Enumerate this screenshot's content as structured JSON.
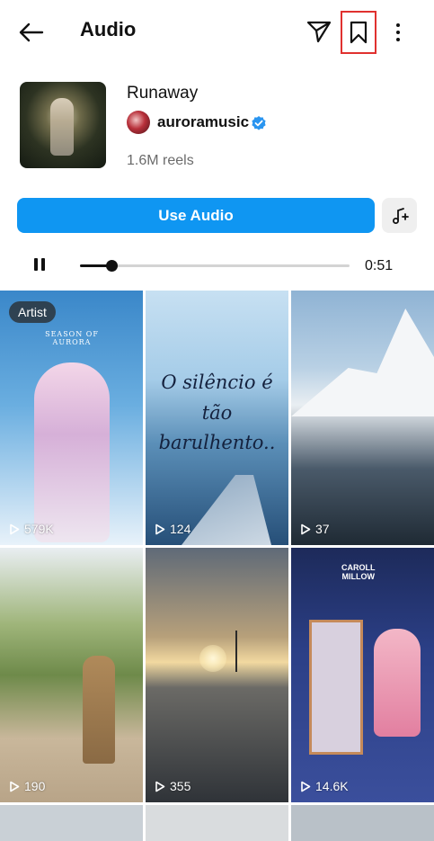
{
  "header": {
    "title": "Audio",
    "icons": [
      "back-arrow-icon",
      "send-icon",
      "bookmark-icon",
      "more-options-icon"
    ]
  },
  "track": {
    "title": "Runaway",
    "artist": "auroramusic",
    "verified": true,
    "reels_count": "1.6M reels"
  },
  "actions": {
    "use_audio_label": "Use Audio",
    "add_icon": "music-note-add-icon"
  },
  "player": {
    "state": "playing",
    "progress_fraction": 0.115,
    "duration": "0:51"
  },
  "reels": [
    {
      "count": "579K",
      "badge": "Artist",
      "caption": "SEASON OF AURORA"
    },
    {
      "count": "124",
      "caption_lines": [
        "O silêncio é tão",
        "barulhento.."
      ]
    },
    {
      "count": "37"
    },
    {
      "count": "190"
    },
    {
      "count": "355"
    },
    {
      "count": "14.6K",
      "caption_lines": [
        "CAROLL",
        "MILLOW"
      ]
    }
  ],
  "colors": {
    "accent": "#0f96f2",
    "highlight_box": "#e0312f"
  }
}
